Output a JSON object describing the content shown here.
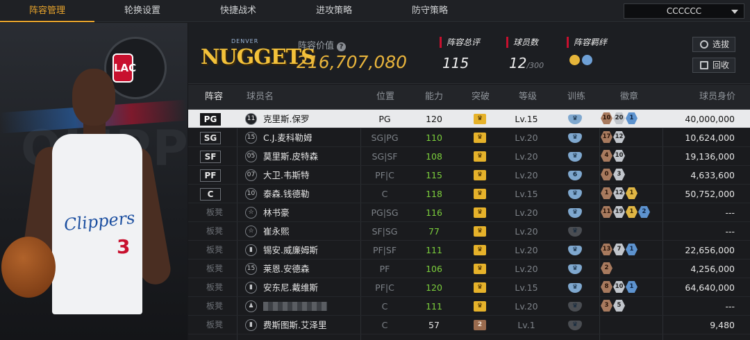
{
  "nav": {
    "tabs": [
      "阵容管理",
      "轮换设置",
      "快捷战术",
      "进攻策略",
      "防守策略"
    ],
    "active_tab": 0,
    "team_selector": "CCCCCC"
  },
  "header": {
    "team_logo_text": "NUGGETS",
    "team_logo_subtext": "DENVER",
    "value_label": "阵容价值",
    "value": "216,707,080",
    "overall_label": "阵容总评",
    "overall_value": "115",
    "players_label": "球员数",
    "players_value": "12",
    "players_max": "/300",
    "bond_label": "阵容羁绊",
    "select_button": "选拔",
    "recycle_button": "回收"
  },
  "featured_player": {
    "team": "LAC",
    "jersey_text": "Clippers",
    "jersey_number": "3",
    "bg_word": "OLIPPER"
  },
  "colors": {
    "accent": "#e8a42c",
    "value_gold": "#e8b43c",
    "stat_marker": "#c8102e",
    "green_ability": "#7ccf3c",
    "selected_row": "#e9eaec"
  },
  "table": {
    "columns": [
      "阵容",
      "球员名",
      "位置",
      "能力",
      "突破",
      "等级",
      "训练",
      "徽章",
      "球员身价"
    ],
    "rows": [
      {
        "lineup": "PG",
        "starter": true,
        "number": "11",
        "name": "克里斯.保罗",
        "position": "PG",
        "ability": "120",
        "ability_green": false,
        "breakthrough": "♛",
        "bt_type": "gold",
        "level": "Lv.15",
        "training": "♛",
        "training_on": true,
        "badges": [
          [
            "br",
            "10"
          ],
          [
            "sv",
            "20"
          ],
          [
            "bl",
            "1"
          ]
        ],
        "price": "40,000,000"
      },
      {
        "lineup": "SG",
        "starter": true,
        "number": "15",
        "name": "C.J.麦科勒姆",
        "position": "SG|PG",
        "ability": "110",
        "ability_green": true,
        "breakthrough": "♛",
        "bt_type": "gold",
        "level": "Lv.20",
        "training": "♛",
        "training_on": true,
        "badges": [
          [
            "br",
            "17"
          ],
          [
            "sv",
            "12"
          ]
        ],
        "price": "10,624,000"
      },
      {
        "lineup": "SF",
        "starter": true,
        "number": "05",
        "name": "莫里斯.皮特森",
        "position": "SG|SF",
        "ability": "108",
        "ability_green": true,
        "breakthrough": "♛",
        "bt_type": "gold",
        "level": "Lv.20",
        "training": "♛",
        "training_on": true,
        "badges": [
          [
            "br",
            "4"
          ],
          [
            "sv",
            "10"
          ]
        ],
        "price": "19,136,000"
      },
      {
        "lineup": "PF",
        "starter": true,
        "number": "07",
        "name": "大卫.韦斯特",
        "position": "PF|C",
        "ability": "115",
        "ability_green": true,
        "breakthrough": "♛",
        "bt_type": "gold",
        "level": "Lv.20",
        "training": "6",
        "training_on": true,
        "badges": [
          [
            "br",
            "0"
          ],
          [
            "sv",
            "3"
          ]
        ],
        "price": "4,633,600"
      },
      {
        "lineup": "C",
        "starter": true,
        "number": "10",
        "name": "泰森.钱德勒",
        "position": "C",
        "ability": "118",
        "ability_green": true,
        "breakthrough": "♛",
        "bt_type": "gold",
        "level": "Lv.15",
        "training": "♛",
        "training_on": true,
        "badges": [
          [
            "br",
            "1"
          ],
          [
            "sv",
            "12"
          ],
          [
            "gd",
            "1"
          ]
        ],
        "price": "50,752,000"
      },
      {
        "lineup": "板凳",
        "starter": false,
        "number": "☆",
        "name": "林书豪",
        "position": "PG|SG",
        "ability": "116",
        "ability_green": true,
        "breakthrough": "♛",
        "bt_type": "gold",
        "level": "Lv.20",
        "training": "♛",
        "training_on": true,
        "badges": [
          [
            "br",
            "11"
          ],
          [
            "sv",
            "19"
          ],
          [
            "gd",
            "1"
          ],
          [
            "bl",
            "2"
          ]
        ],
        "price": "---"
      },
      {
        "lineup": "板凳",
        "starter": false,
        "number": "☆",
        "name": "崔永熙",
        "position": "SF|SG",
        "ability": "77",
        "ability_green": true,
        "breakthrough": "♛",
        "bt_type": "gold",
        "level": "Lv.20",
        "training": "♛",
        "training_on": false,
        "badges": [],
        "price": "---"
      },
      {
        "lineup": "板凳",
        "starter": false,
        "number": "▮",
        "name": "锡安.威廉姆斯",
        "position": "PF|SF",
        "ability": "111",
        "ability_green": true,
        "breakthrough": "♛",
        "bt_type": "gold",
        "level": "Lv.20",
        "training": "♛",
        "training_on": true,
        "badges": [
          [
            "br",
            "13"
          ],
          [
            "sv",
            "7"
          ],
          [
            "bl",
            "1"
          ]
        ],
        "price": "22,656,000"
      },
      {
        "lineup": "板凳",
        "starter": false,
        "number": "15",
        "name": "莱恩.安德森",
        "position": "PF",
        "ability": "106",
        "ability_green": true,
        "breakthrough": "♛",
        "bt_type": "gold",
        "level": "Lv.20",
        "training": "♛",
        "training_on": true,
        "badges": [
          [
            "br",
            "2"
          ]
        ],
        "price": "4,256,000"
      },
      {
        "lineup": "板凳",
        "starter": false,
        "number": "▮",
        "name": "安东尼.戴维斯",
        "position": "PF|C",
        "ability": "120",
        "ability_green": true,
        "breakthrough": "♛",
        "bt_type": "gold",
        "level": "Lv.15",
        "training": "♛",
        "training_on": true,
        "badges": [
          [
            "br",
            "8"
          ],
          [
            "sv",
            "10"
          ],
          [
            "bl",
            "1"
          ]
        ],
        "price": "64,640,000"
      },
      {
        "lineup": "板凳",
        "starter": false,
        "number": "♟",
        "name": "",
        "position": "C",
        "ability": "111",
        "ability_green": true,
        "breakthrough": "♛",
        "bt_type": "gold",
        "level": "Lv.20",
        "training": "♛",
        "training_on": false,
        "badges": [
          [
            "br",
            "3"
          ],
          [
            "sv",
            "5"
          ]
        ],
        "price": "---",
        "blurred": true
      },
      {
        "lineup": "板凳",
        "starter": false,
        "number": "▮",
        "name": "费斯图斯.艾泽里",
        "position": "C",
        "ability": "57",
        "ability_green": false,
        "breakthrough": "2",
        "bt_type": "bronze",
        "level": "Lv.1",
        "training": "♛",
        "training_on": false,
        "badges": [],
        "price": "9,480"
      }
    ]
  }
}
